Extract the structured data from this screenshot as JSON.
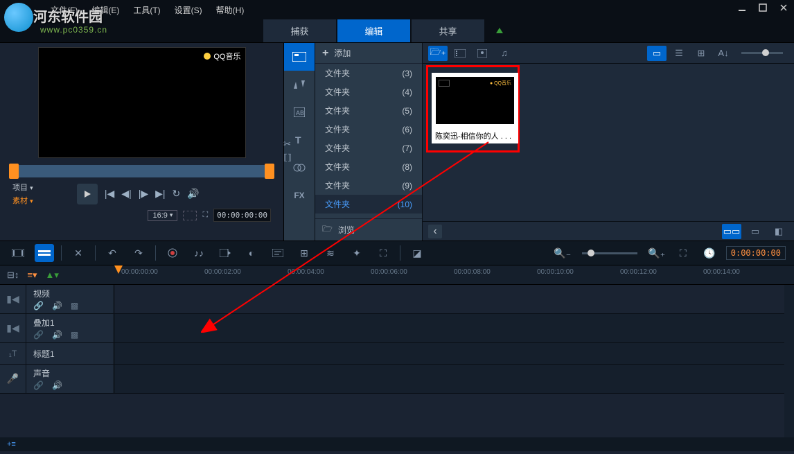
{
  "watermark": {
    "text": "河东软件园",
    "url": "www.pc0359.cn"
  },
  "menu": {
    "file": "文件(F)",
    "edit": "编辑(E)",
    "tools": "工具(T)",
    "settings": "设置(S)",
    "help": "帮助(H)"
  },
  "modes": {
    "capture": "捕获",
    "edit": "编辑",
    "share": "共享"
  },
  "preview": {
    "badge": "QQ音乐",
    "project_label": "项目",
    "clip_label": "素材",
    "aspect": "16:9",
    "timecode": "00:00:00:00"
  },
  "library": {
    "add_label": "添加",
    "folders": [
      {
        "name": "文件夹",
        "count": "(3)"
      },
      {
        "name": "文件夹",
        "count": "(4)"
      },
      {
        "name": "文件夹",
        "count": "(5)"
      },
      {
        "name": "文件夹",
        "count": "(6)"
      },
      {
        "name": "文件夹",
        "count": "(7)"
      },
      {
        "name": "文件夹",
        "count": "(8)"
      },
      {
        "name": "文件夹",
        "count": "(9)"
      },
      {
        "name": "文件夹",
        "count": "(10)"
      }
    ],
    "selected_index": 7,
    "browse_label": "浏览",
    "media_item": {
      "caption": "陈奕迅-相信你的人 . . ."
    }
  },
  "timeline": {
    "ruler": [
      "00:00:00:00",
      "00:00:02:00",
      "00:00:04:00",
      "00:00:06:00",
      "00:00:08:00",
      "00:00:10:00",
      "00:00:12:00",
      "00:00:14:00"
    ],
    "timecode": "0:00:00:00",
    "tracks": {
      "video": "视频",
      "overlay": "叠加1",
      "title": "标题1",
      "audio": "声音"
    },
    "add_track": "+≡"
  }
}
